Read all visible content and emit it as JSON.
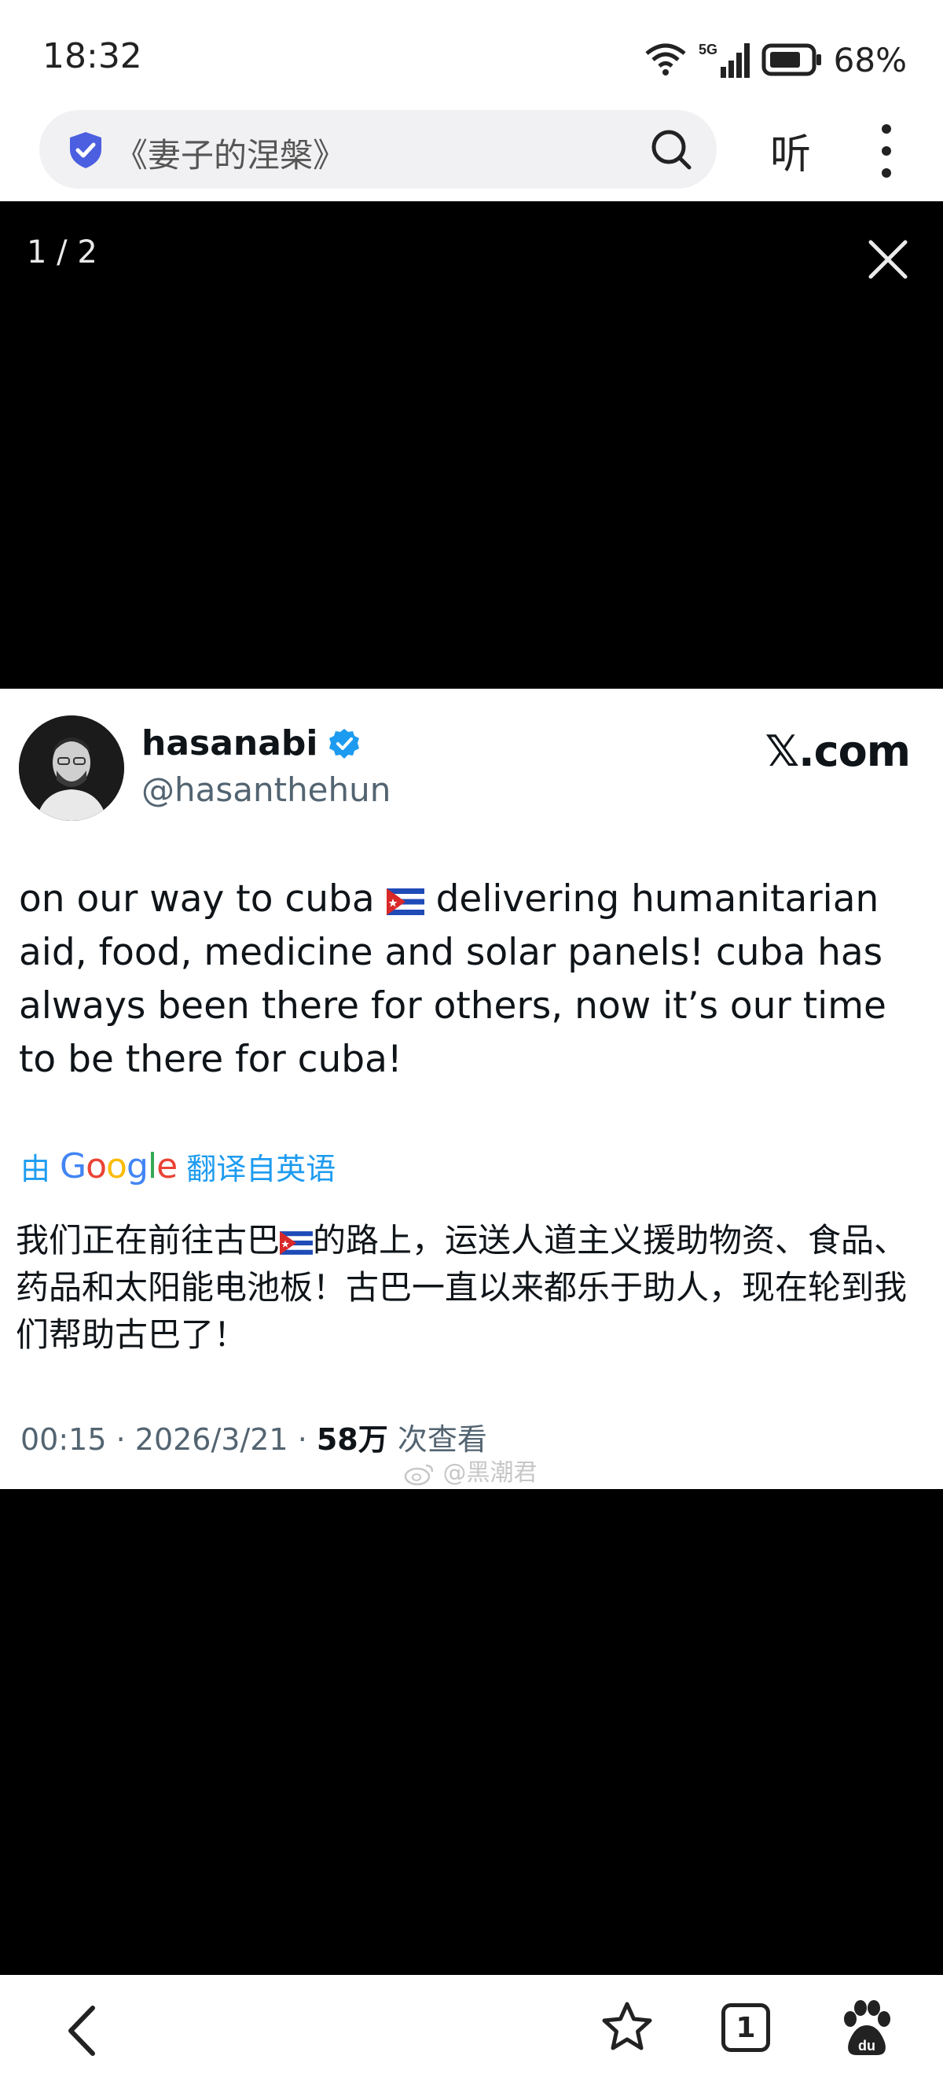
{
  "status_bar": {
    "time": "18:32",
    "network": "5G",
    "battery": "68%"
  },
  "browser": {
    "search_text": "《妻子的涅槃》",
    "listen_label": "听"
  },
  "viewer": {
    "page_counter": "1 / 2"
  },
  "tweet": {
    "display_name": "hasanabi",
    "handle": "@hasanthehun",
    "source": "𝕏.com",
    "text_part1": "on our way to cuba ",
    "text_part2": " delivering humanitarian aid, food, medicine and solar panels! cuba has always been there for others, now it’s our time to be there for cuba!",
    "translate_by": "由",
    "translate_provider": "Google",
    "translate_from": "翻译自英语",
    "translated_part1": "我们正在前往古巴",
    "translated_part2": "的路上，运送人道主义援助物资、食品、药品和太阳能电池板！古巴一直以来都乐于助人，现在轮到我们帮助古巴了！",
    "time": "00:15",
    "date": "2026/3/21",
    "views_count": "58万",
    "views_label": " 次查看"
  },
  "watermark": "@黑潮君",
  "bottom_nav": {
    "tab_count": "1"
  },
  "colors": {
    "accent_blue": "#1d9bf0",
    "verified_blue": "#1d9bf0",
    "shield_blue": "#4b5fe0"
  }
}
